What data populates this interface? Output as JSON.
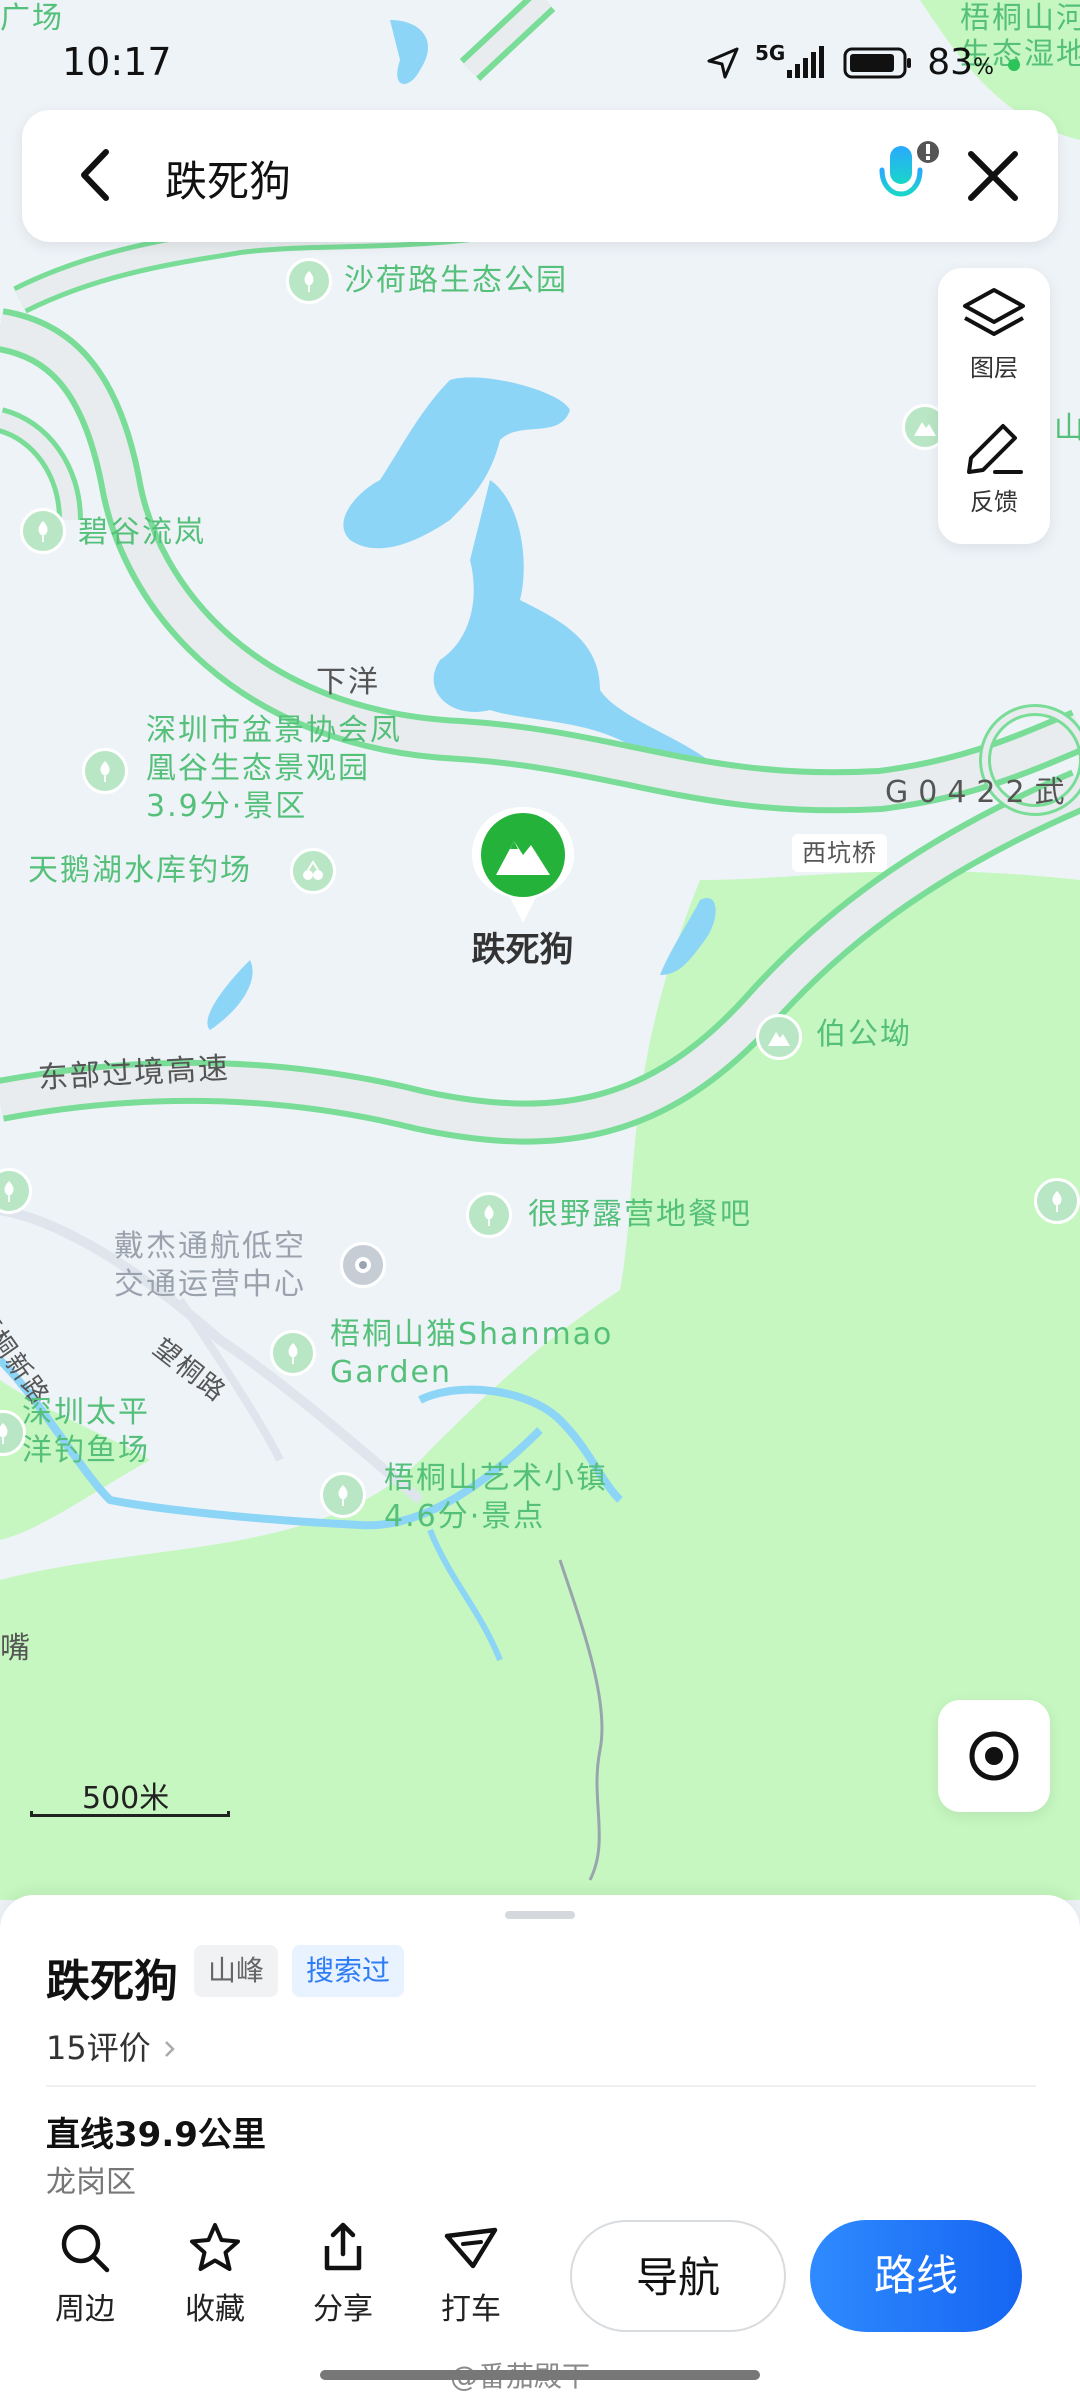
{
  "status": {
    "time": "10:17",
    "network": "5G",
    "battery": "83",
    "battery_unit": "%"
  },
  "search": {
    "query": "跌死狗"
  },
  "side_panel": {
    "layers_label": "图层",
    "feedback_label": "反馈"
  },
  "map": {
    "labels": {
      "guangchang": "广场",
      "wutong_wetland_1": "梧桐山河",
      "wutong_wetland_2": "生态湿地",
      "shahe_park": "沙荷路生态公园",
      "bigu": "碧谷流岚",
      "xiayang": "下洋",
      "penjing_1": "深圳市盆景协会凤",
      "penjing_2": "凰谷生态景观园",
      "penjing_3": "3.9分·景区",
      "tiane": "天鹅湖水库钓场",
      "highway_g": "G0422武",
      "xikengqiao": "西坑桥",
      "eastern_expressway": "东部过境高速",
      "bogong": "伯公坳",
      "henye": "很野露营地餐吧",
      "daijie_1": "戴杰通航低空",
      "daijie_2": "交通运营中心",
      "wutong_road_1": "梧桐新路",
      "wangtong_road": "望桐路",
      "shanmao_1": "梧桐山猫Shanmao",
      "shanmao_2": "Garden",
      "taiping_1": "深圳太平",
      "taiping_2": "洋钓鱼场",
      "art_town_1": "梧桐山艺术小镇",
      "art_town_2": "4.6分·景点",
      "zui": "嘴",
      "right_edge": "山"
    },
    "pin_label": "跌死狗",
    "scale": "500米"
  },
  "place": {
    "name": "跌死狗",
    "type_tag": "山峰",
    "history_tag": "搜索过",
    "reviews": "15评价",
    "distance": "直线39.9公里",
    "district": "龙岗区"
  },
  "actions": {
    "nearby": "周边",
    "favorite": "收藏",
    "share": "分享",
    "taxi": "打车",
    "navigate": "导航",
    "route": "路线"
  },
  "watermark": "@番茄殿下",
  "colors": {
    "road_green": "#79dd97",
    "forest": "#c6f7c0",
    "water": "#8dd5f6",
    "accent_blue": "#1f76f5",
    "poi_green": "#55c07a"
  }
}
